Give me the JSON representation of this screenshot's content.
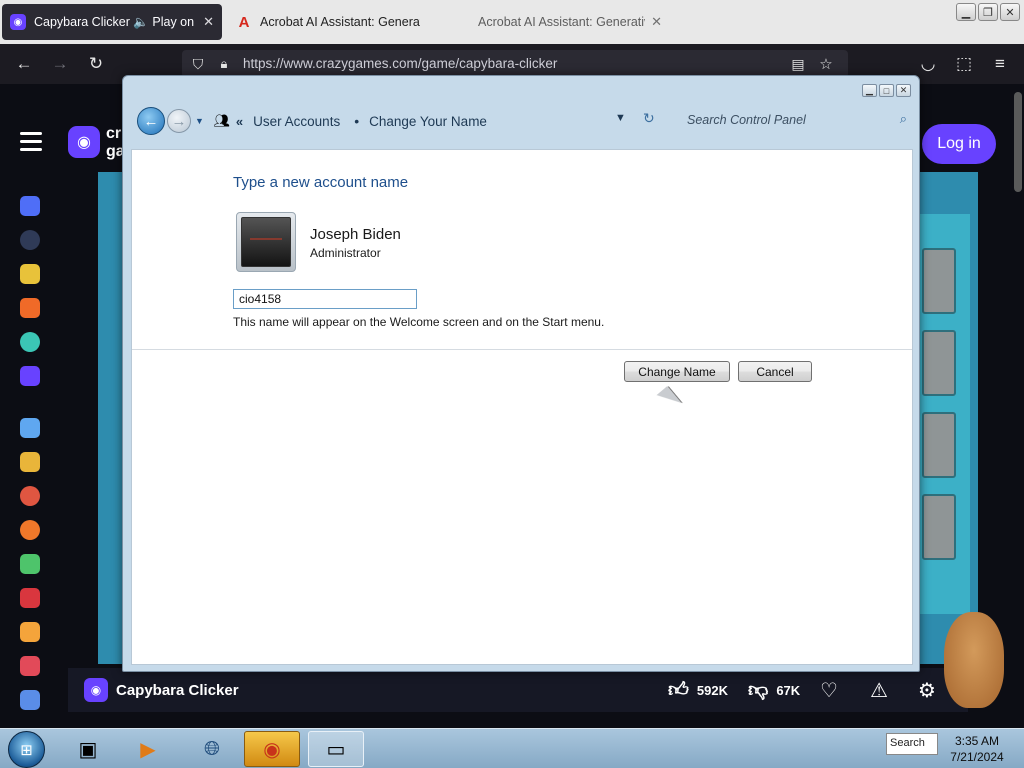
{
  "browser": {
    "tabs": [
      {
        "title": "Capybara Clicker 🔈 Play on Cra",
        "active": true
      },
      {
        "title": "Acrobat AI Assistant: Generative"
      },
      {
        "title": "Acrobat AI Assistant: Generative"
      }
    ],
    "url": "https://www.crazygames.com/game/capybara-clicker",
    "close_glyph": "✕"
  },
  "site": {
    "logo_letters": "cr\nga",
    "login_label": "Log in",
    "game_title": "Capybara Clicker",
    "likes": "592K",
    "dislikes": "67K"
  },
  "dialog": {
    "breadcrumb": [
      "User Accounts",
      "Change Your Name"
    ],
    "search_placeholder": "Search Control Panel",
    "heading": "Type a new account name",
    "user_name": "Joseph Biden",
    "user_role": "Administrator",
    "name_value": "cio4158",
    "help_text": "This name will appear on the Welcome screen and on the Start menu.",
    "change_button": "Change Name",
    "cancel_button": "Cancel"
  },
  "taskbar": {
    "search_text": "Search",
    "time": "3:35 AM",
    "date": "7/21/2024"
  },
  "colors": {
    "brand_purple": "#6842ff",
    "dialog_link_blue": "#1e4f8c"
  }
}
